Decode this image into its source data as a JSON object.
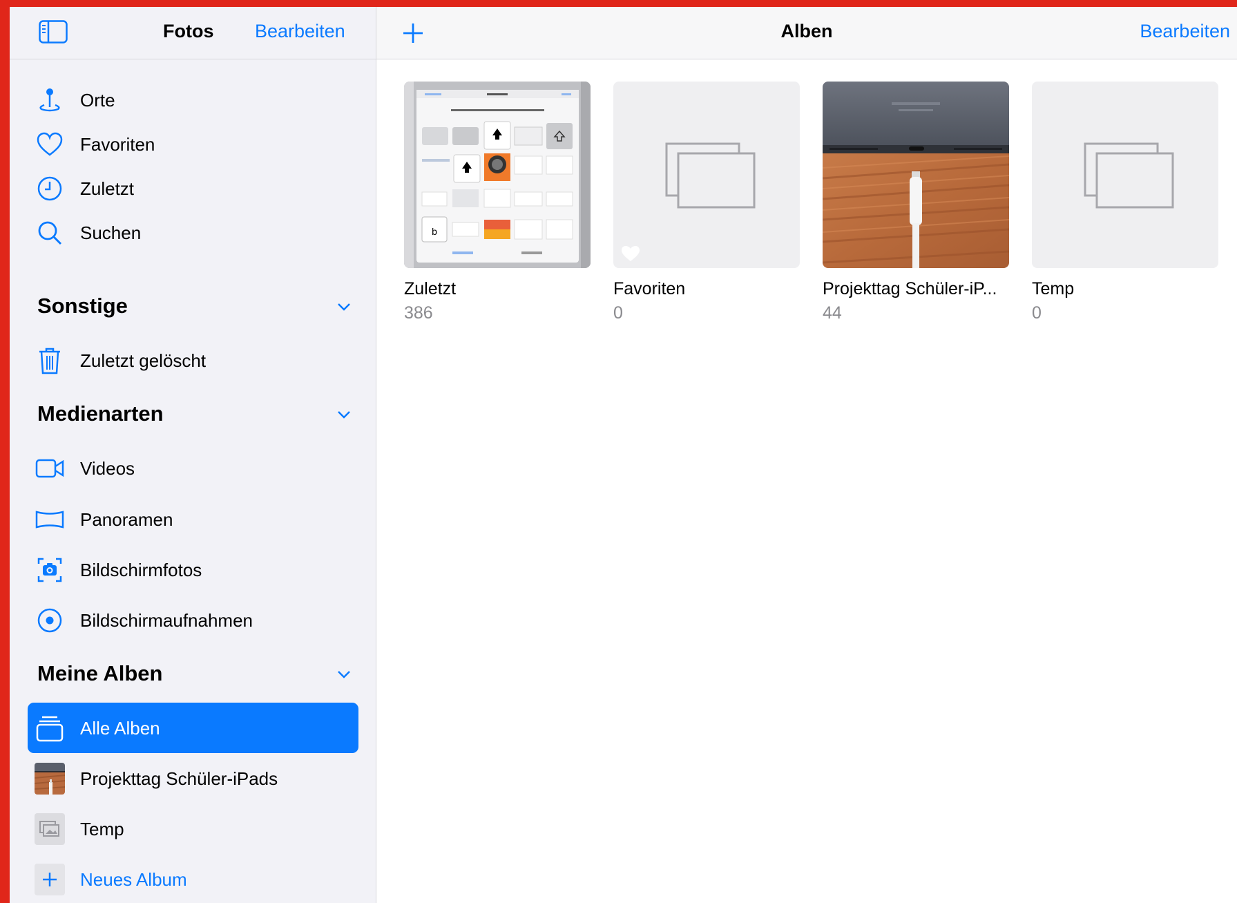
{
  "sidebar": {
    "title": "Fotos",
    "edit_label": "Bearbeiten",
    "items": [
      {
        "label": "Orte",
        "icon": "pin-icon"
      },
      {
        "label": "Favoriten",
        "icon": "heart-icon"
      },
      {
        "label": "Zuletzt",
        "icon": "clock-icon"
      },
      {
        "label": "Suchen",
        "icon": "search-icon"
      }
    ],
    "sections": {
      "sonstige": {
        "title": "Sonstige",
        "items": [
          {
            "label": "Zuletzt gelöscht",
            "icon": "trash-icon"
          }
        ]
      },
      "medienarten": {
        "title": "Medienarten",
        "items": [
          {
            "label": "Videos",
            "icon": "video-icon"
          },
          {
            "label": "Panoramen",
            "icon": "panorama-icon"
          },
          {
            "label": "Bildschirmfotos",
            "icon": "screenshot-icon"
          },
          {
            "label": "Bildschirmaufnahmen",
            "icon": "screen-recording-icon"
          }
        ]
      },
      "meine_alben": {
        "title": "Meine Alben",
        "items": [
          {
            "label": "Alle Alben",
            "icon": "albums-stack-icon",
            "selected": true
          },
          {
            "label": "Projekttag Schüler-iPads"
          },
          {
            "label": "Temp"
          }
        ],
        "new_album_label": "Neues Album"
      }
    }
  },
  "main": {
    "title": "Alben",
    "edit_label": "Bearbeiten",
    "albums": [
      {
        "name": "Zuletzt",
        "count": "386"
      },
      {
        "name": "Favoriten",
        "count": "0"
      },
      {
        "name": "Projekttag Schüler-iP...",
        "count": "44"
      },
      {
        "name": "Temp",
        "count": "0"
      }
    ]
  },
  "colors": {
    "accent": "#0a7aff",
    "sidebar_bg": "#f2f2f7",
    "frame": "#e0261a"
  }
}
